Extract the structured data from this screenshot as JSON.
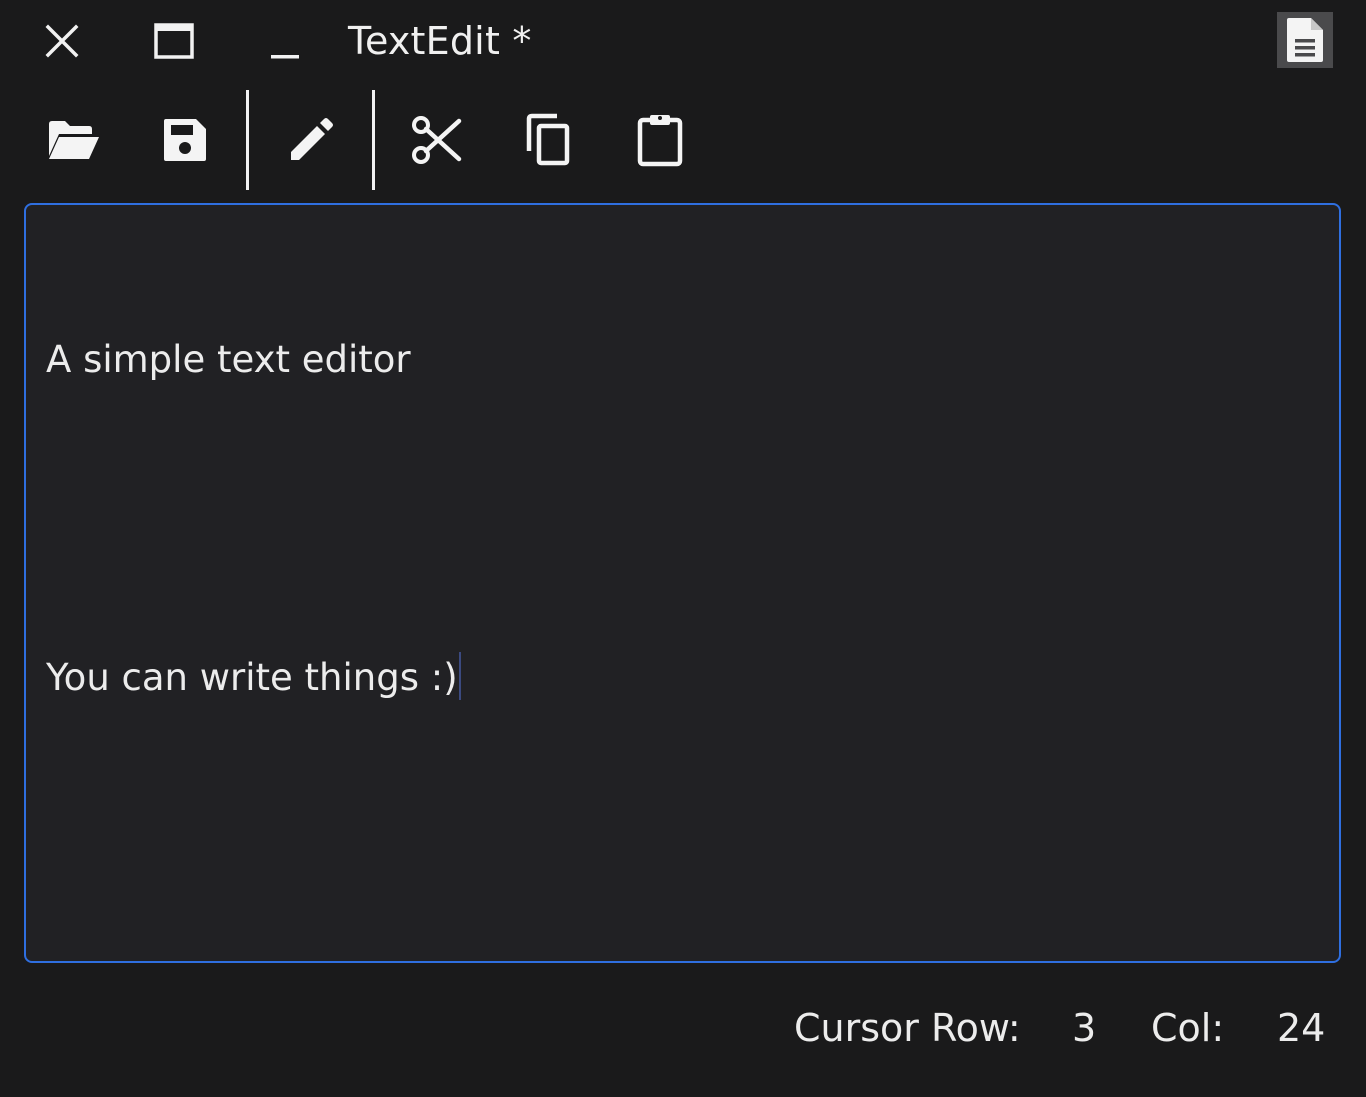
{
  "window": {
    "title": "TextEdit *"
  },
  "titlebar": {
    "close_icon": "close-icon",
    "maximize_icon": "maximize-icon",
    "minimize_icon": "minimize-icon",
    "app_icon": "document-icon"
  },
  "toolbar": {
    "items": [
      {
        "icon": "folder-open-icon"
      },
      {
        "icon": "save-icon"
      },
      {
        "icon": "pencil-icon"
      },
      {
        "icon": "scissors-icon"
      },
      {
        "icon": "copy-icon"
      },
      {
        "icon": "clipboard-icon"
      }
    ]
  },
  "editor": {
    "lines": [
      "A simple text editor",
      "",
      "You can write things :)"
    ]
  },
  "status": {
    "row_label": "Cursor Row:",
    "row_value": "3",
    "col_label": "Col:",
    "col_value": "24"
  },
  "colors": {
    "background": "#1a1a1b",
    "editor_background": "#212124",
    "focus_border": "#2f6fe0",
    "text": "#ececec"
  }
}
